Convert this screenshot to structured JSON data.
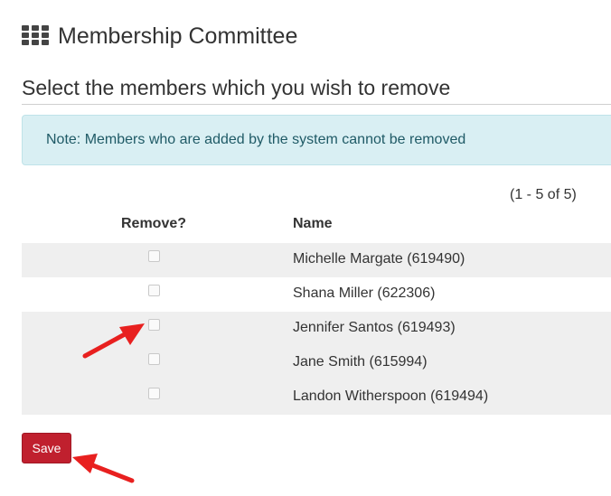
{
  "header": {
    "icon": "grid-icon",
    "title": "Membership Committee"
  },
  "subtitle": "Select the members which you wish to remove",
  "note": "Note: Members who are added by the system cannot be removed",
  "pagination": "(1 - 5 of 5)",
  "table": {
    "columns": [
      "Remove?",
      "Name"
    ],
    "rows": [
      {
        "name": "Michelle Margate (619490)",
        "remove": false
      },
      {
        "name": "Shana Miller (622306)",
        "remove": false
      },
      {
        "name": "Jennifer Santos (619493)",
        "remove": false
      },
      {
        "name": "Jane Smith (615994)",
        "remove": false
      },
      {
        "name": "Landon Witherspoon (619494)",
        "remove": false
      }
    ]
  },
  "save_label": "Save",
  "colors": {
    "save_button": "#c0202e",
    "note_bg": "#d9eff3",
    "annotation_arrow": "#e8201f"
  }
}
